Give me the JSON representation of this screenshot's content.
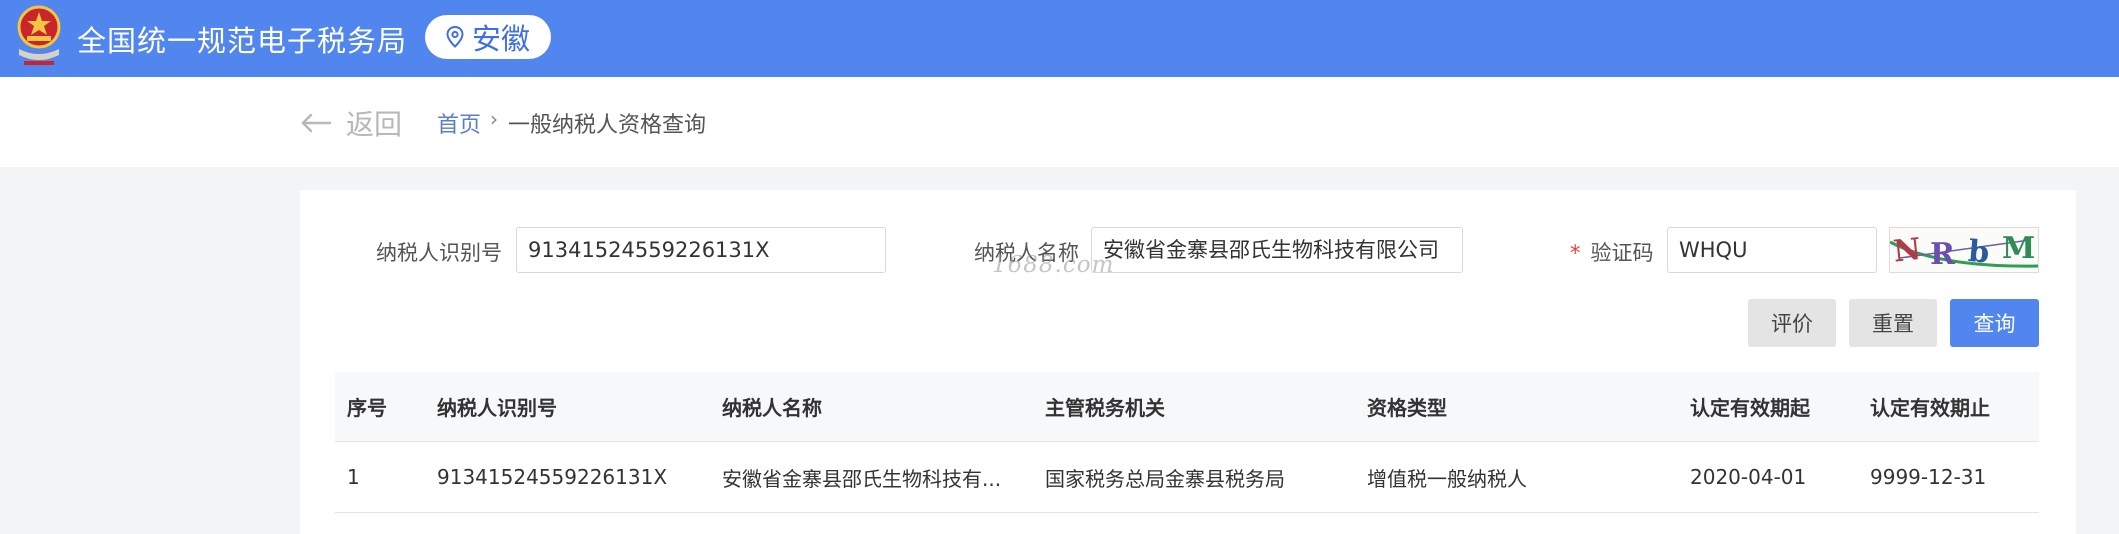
{
  "header": {
    "site_title": "全国统一规范电子税务局",
    "region": "安徽",
    "region_icon": "location-pin-icon"
  },
  "nav": {
    "back_label": "返回",
    "home_label": "首页",
    "separator": "›",
    "current_label": "一般纳税人资格查询"
  },
  "form": {
    "taxpayer_id_label": "纳税人识别号",
    "taxpayer_id_value": "91341524559226131X",
    "taxpayer_name_label": "纳税人名称",
    "taxpayer_name_value": "安徽省金寨县邵氏生物科技有限公司",
    "captcha_required_mark": "*",
    "captcha_label": "验证码",
    "captcha_value": "WHQU",
    "captcha_image_text": "NRbM"
  },
  "buttons": {
    "evaluate": "评价",
    "reset": "重置",
    "query": "查询"
  },
  "table": {
    "headers": [
      "序号",
      "纳税人识别号",
      "纳税人名称",
      "主管税务机关",
      "资格类型",
      "认定有效期起",
      "认定有效期止"
    ],
    "rows": [
      [
        "1",
        "91341524559226131X",
        "安徽省金寨县邵氏生物科技有...",
        "国家税务总局金寨县税务局",
        "增值税一般纳税人",
        "2020-04-01",
        "9999-12-31"
      ]
    ]
  },
  "watermark": "1688.com",
  "colors": {
    "header_bg": "#5286ef",
    "primary_button": "#5286ef",
    "link": "#5b7fc7",
    "required": "#e0442b"
  }
}
